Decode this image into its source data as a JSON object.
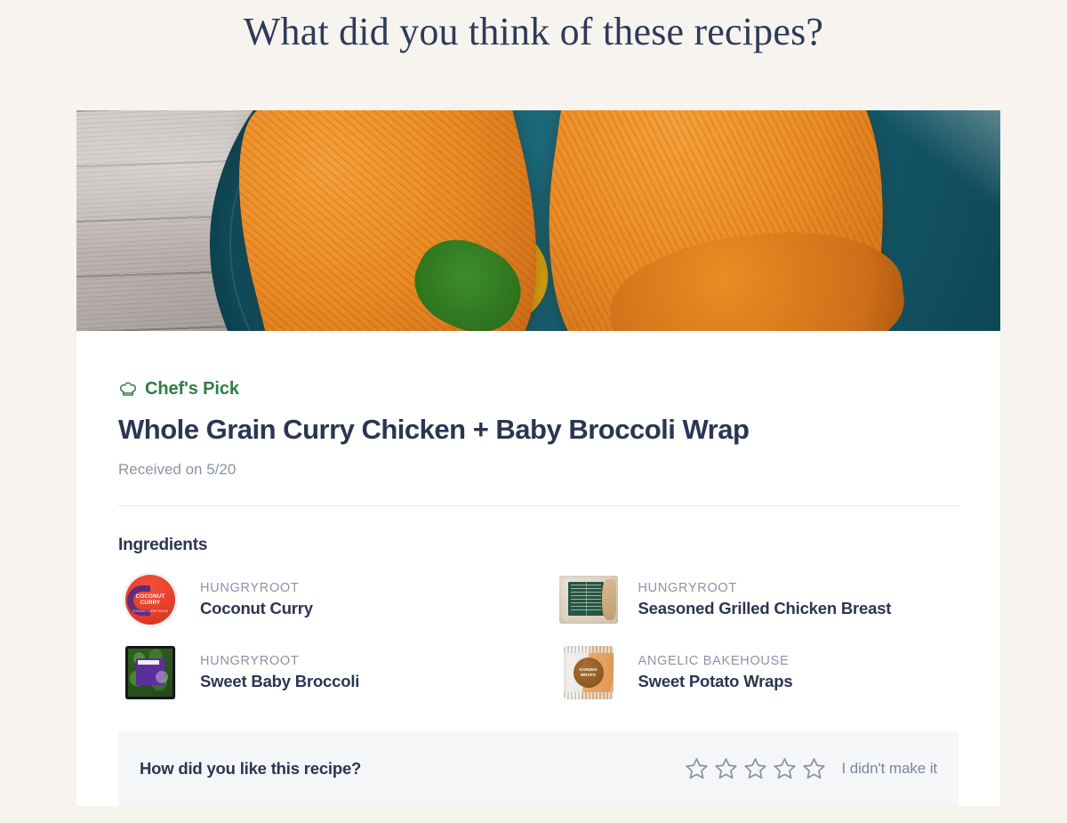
{
  "page": {
    "heading": "What did you think of these recipes?",
    "background_color": "#f7f4ef",
    "text_color": "#2e3a59"
  },
  "recipe_card": {
    "hero_image_alt": "Two sweet potato wrap halves with chicken and broccolini on a dark teal plate",
    "badge": {
      "icon": "chef-hat-icon",
      "label": "Chef's Pick",
      "color": "#2f7d44"
    },
    "title": "Whole Grain Curry Chicken + Baby Broccoli Wrap",
    "received": "Received on 5/20",
    "ingredients_heading": "Ingredients",
    "ingredients": [
      {
        "brand": "HUNGRYROOT",
        "name": "Coconut Curry",
        "thumb": "coconut-curry-tub",
        "thumb_label_line1": "COCONUT",
        "thumb_label_line2": "CURRY",
        "thumb_sublabel": "COCONUT CURRY SAUCE",
        "thumb_color": "#e6402c"
      },
      {
        "brand": "HUNGRYROOT",
        "name": "Seasoned Grilled Chicken Breast",
        "thumb": "chicken-breast-package",
        "thumb_color": "#255742"
      },
      {
        "brand": "HUNGRYROOT",
        "name": "Sweet Baby Broccoli",
        "thumb": "sweet-baby-broccoli-package",
        "thumb_color": "#5b2e9c"
      },
      {
        "brand": "ANGELIC BAKEHOUSE",
        "name": "Sweet Potato Wraps",
        "thumb": "sweet-potato-wraps-package",
        "thumb_label_line1": "GARDEN",
        "thumb_label_line2": "WRAPS",
        "thumb_color": "#8e5a22"
      }
    ],
    "rating": {
      "question": "How did you like this recipe?",
      "stars_total": 5,
      "stars_selected": 0,
      "star_color": "#8a90a2",
      "skip_label": "I didn't make it"
    }
  }
}
